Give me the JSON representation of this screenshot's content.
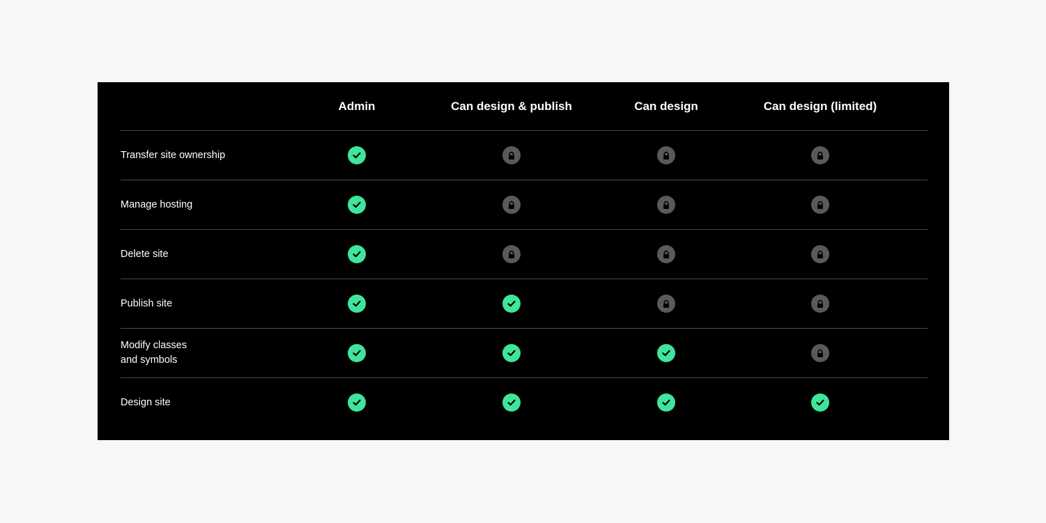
{
  "colors": {
    "page_background": "#f6f7f9",
    "panel_background": "#000000",
    "allowed": "#3fe59a",
    "locked": "#5a5a5a",
    "divider": "#4a4a4a"
  },
  "columns": [
    "Admin",
    "Can design & publish",
    "Can design",
    "Can design (limited)"
  ],
  "rows": [
    {
      "label": "Transfer site ownership",
      "permissions": [
        "check-icon",
        "lock-icon",
        "lock-icon",
        "lock-icon"
      ]
    },
    {
      "label": "Manage hosting",
      "permissions": [
        "check-icon",
        "lock-icon",
        "lock-icon",
        "lock-icon"
      ]
    },
    {
      "label": "Delete site",
      "permissions": [
        "check-icon",
        "lock-icon",
        "lock-icon",
        "lock-icon"
      ]
    },
    {
      "label": "Publish site",
      "permissions": [
        "check-icon",
        "check-icon",
        "lock-icon",
        "lock-icon"
      ]
    },
    {
      "label": "Modify classes\nand symbols",
      "permissions": [
        "check-icon",
        "check-icon",
        "check-icon",
        "lock-icon"
      ]
    },
    {
      "label": "Design site",
      "permissions": [
        "check-icon",
        "check-icon",
        "check-icon",
        "check-icon"
      ]
    }
  ]
}
